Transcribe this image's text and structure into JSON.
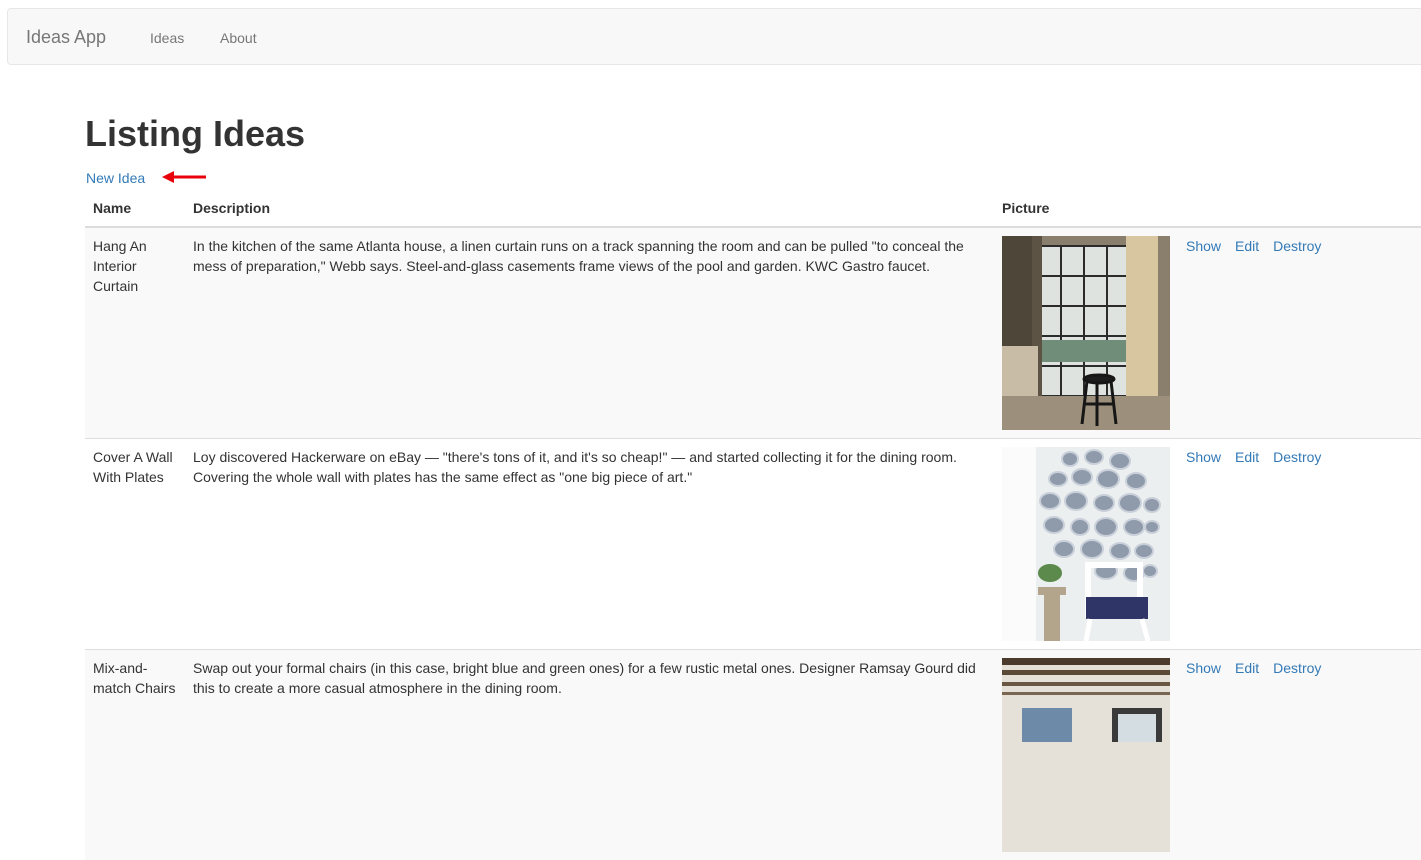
{
  "navbar": {
    "brand": "Ideas App",
    "links": [
      "Ideas",
      "About"
    ]
  },
  "page": {
    "title": "Listing Ideas",
    "new_link": "New Idea"
  },
  "table": {
    "headers": [
      "Name",
      "Description",
      "Picture",
      ""
    ],
    "rows": [
      {
        "name": "Hang An Interior Curtain",
        "description": "In the kitchen of the same Atlanta house, a linen curtain runs on a track spanning the room and can be pulled \"to conceal the mess of preparation,\" Webb says. Steel-and-glass casements frame views of the pool and garden. KWC Gastro faucet.",
        "actions": [
          "Show",
          "Edit",
          "Destroy"
        ]
      },
      {
        "name": "Cover A Wall With Plates",
        "description": "Loy discovered Hackerware on eBay — \"there's tons of it, and it's so cheap!\" — and started collecting it for the dining room. Covering the whole wall with plates has the same effect as \"one big piece of art.\"",
        "actions": [
          "Show",
          "Edit",
          "Destroy"
        ]
      },
      {
        "name": "Mix-and-match Chairs",
        "description": "Swap out your formal chairs (in this case, bright blue and green ones) for a few rustic metal ones. Designer Ramsay Gourd did this to create a more casual atmosphere in the dining room.",
        "actions": [
          "Show",
          "Edit",
          "Destroy"
        ]
      }
    ]
  },
  "colors": {
    "link": "#337ab7",
    "arrow": "#e8000b",
    "navbar_bg": "#f8f8f8",
    "row_stripe": "#f9f9f9"
  }
}
